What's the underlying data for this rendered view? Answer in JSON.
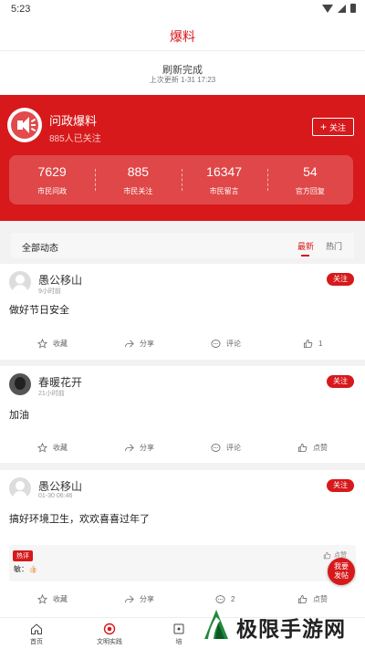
{
  "status": {
    "time": "5:23"
  },
  "header": {
    "title": "爆料"
  },
  "refresh": {
    "status": "刷新完成",
    "last_update": "上次更新 1-31 17:23"
  },
  "channel": {
    "name": "问政爆料",
    "followers": "885人已关注",
    "follow_label": "关注",
    "stats": [
      {
        "value": "7629",
        "label": "市民问政"
      },
      {
        "value": "885",
        "label": "市民关注"
      },
      {
        "value": "16347",
        "label": "市民留言"
      },
      {
        "value": "54",
        "label": "官方回复"
      }
    ]
  },
  "feed": {
    "title": "全部动态",
    "tab_latest": "最新",
    "tab_hot": "热门"
  },
  "posts": [
    {
      "user": "愚公移山",
      "time": "9小时前",
      "follow": "关注",
      "content": "做好节日安全",
      "actions": {
        "collect": "收藏",
        "share": "分享",
        "comment": "评论",
        "like": "1"
      }
    },
    {
      "user": "春暖花开",
      "time": "21小时前",
      "follow": "关注",
      "content": "加油",
      "actions": {
        "collect": "收藏",
        "share": "分享",
        "comment": "评论",
        "like": "点赞"
      }
    },
    {
      "user": "愚公移山",
      "time": "01-30 06:46",
      "follow": "关注",
      "content": "搞好环境卫生，欢欢喜喜过年了",
      "hot_review": {
        "tag": "热评",
        "text": "敏：👍🏻",
        "like": "点赞"
      },
      "actions": {
        "collect": "收藏",
        "share": "分享",
        "comment": "2",
        "like": "点赞"
      }
    }
  ],
  "fab": {
    "line1": "我要",
    "line2": "发帖"
  },
  "bottom_nav": [
    {
      "label": "首页",
      "icon": "home-icon"
    },
    {
      "label": "文明实践",
      "icon": "practice-icon"
    },
    {
      "label": "培",
      "icon": "training-icon"
    }
  ],
  "watermark": {
    "text": "极限手游网"
  },
  "colors": {
    "accent": "#d7191b",
    "background": "#f2f2f2"
  }
}
